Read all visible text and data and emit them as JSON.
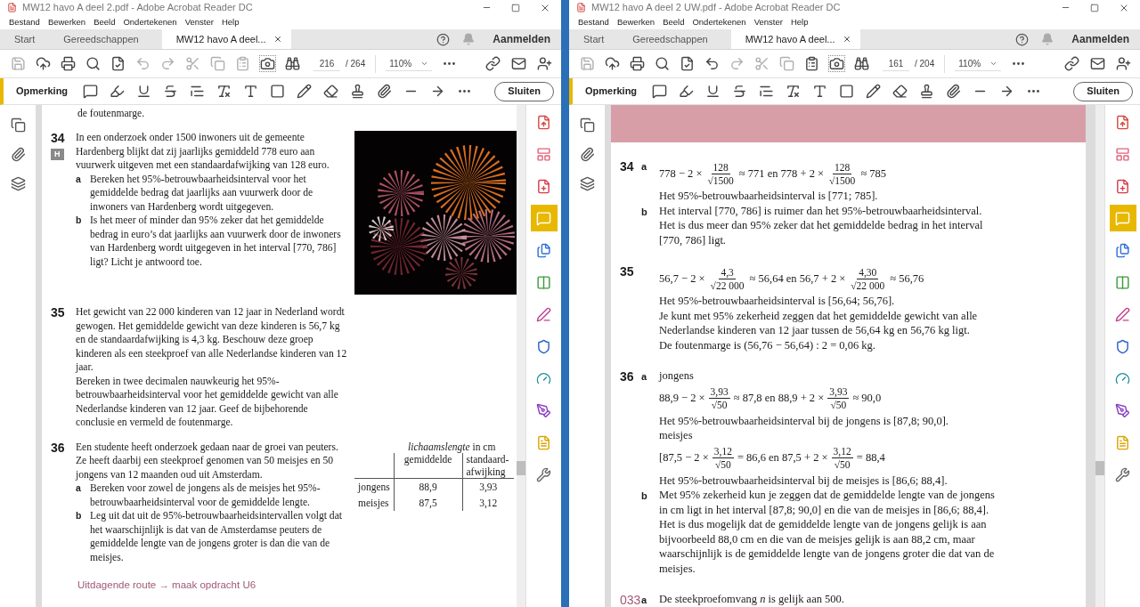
{
  "windows": [
    {
      "title": "MW12 havo A deel 2.pdf - Adobe Acrobat Reader DC",
      "menu": [
        "Bestand",
        "Bewerken",
        "Beeld",
        "Ondertekenen",
        "Venster",
        "Help"
      ],
      "tabs": [
        {
          "label": "Start",
          "selected": false
        },
        {
          "label": "Gereedschappen",
          "selected": false
        },
        {
          "label": "MW12 havo A deel...",
          "selected": true
        }
      ],
      "sign_in": "Aanmelden",
      "toolbar": {
        "page": "216",
        "total": "/ 264",
        "zoom": "110%",
        "undo_enabled": false,
        "paste_enabled": false
      },
      "comment_bar": {
        "label": "Opmerking",
        "close": "Sluiten"
      },
      "tools": [
        {
          "kind": "export",
          "selected": false
        },
        {
          "kind": "layout",
          "selected": false
        },
        {
          "kind": "create",
          "selected": false
        },
        {
          "kind": "comment",
          "selected": true
        },
        {
          "kind": "combine",
          "selected": false
        },
        {
          "kind": "organize",
          "selected": false
        },
        {
          "kind": "fill",
          "selected": false
        },
        {
          "kind": "protect",
          "selected": false
        },
        {
          "kind": "optimize",
          "selected": false
        },
        {
          "kind": "sign",
          "selected": false
        },
        {
          "kind": "send",
          "selected": false
        },
        {
          "kind": "more",
          "selected": false
        }
      ],
      "page": {
        "kind": "exercises",
        "header_band": false,
        "blocks": [
          {
            "kind": "text",
            "text": "de foutenmarge."
          },
          {
            "kind": "exercise",
            "number": "34",
            "badge": "H",
            "paragraphs": [
              "In een onderzoek onder 1500 inwoners uit de gemeente Hardenberg blijkt dat zij jaarlijks gemiddeld 778 euro aan vuurwerk uitgeven met een standaardafwijking van 128 euro."
            ],
            "items": [
              {
                "letter": "a",
                "text": "Bereken het 95%-betrouwbaarheidsinterval voor het gemiddelde bedrag dat jaarlijks aan vuurwerk door de inwoners van Hardenberg wordt uitgegeven."
              },
              {
                "letter": "b",
                "text": "Is het meer of minder dan 95% zeker dat het gemiddelde bedrag in euro’s dat jaarlijks aan vuurwerk door de inwoners van Hardenberg wordt uitgegeven in het interval [770, 786] ligt? Licht je antwoord toe."
              }
            ],
            "aside": {
              "kind": "picture"
            }
          },
          {
            "kind": "exercise",
            "number": "35",
            "paragraphs": [
              "Het gewicht van 22 000 kinderen van 12 jaar in Nederland wordt gewogen. Het gemiddelde gewicht van deze kinderen is 56,7 kg en de standaardafwijking is 4,3 kg. Beschouw deze groep kinderen als een steekproef van alle Nederlandse kinderen van 12 jaar.",
              "Bereken in twee decimalen nauwkeurig het 95%-betrouwbaarheidsinterval voor het gemiddelde gewicht van alle Nederlandse kinderen van 12 jaar. Geef de bijbehorende conclusie en vermeld de foutenmarge."
            ]
          },
          {
            "kind": "exercise",
            "number": "36",
            "paragraphs": [
              "Een studente heeft onderzoek gedaan naar de groei van peuters. Ze heeft daarbij een steekproef genomen van 50 meisjes en 50 jongens van 12 maanden oud uit Amsterdam."
            ],
            "items": [
              {
                "letter": "a",
                "text": "Bereken voor zowel de jongens als de meisjes het 95%-betrouwbaarheidsinterval voor de gemiddelde lengte."
              },
              {
                "letter": "b",
                "text": "Leg uit dat uit de 95%-betrouwbaarheidsintervallen volgt dat het waarschijnlijk is dat van de Amsterdamse peuters de gemiddelde lengte van de jongens groter is dan die van de meisjes."
              }
            ],
            "aside": {
              "kind": "table",
              "caption": "*lichaamslengte* in cm",
              "columns": [
                "",
                "gemiddelde",
                "standaard-afwijking"
              ],
              "rows": [
                [
                  "jongens",
                  "88,9",
                  "3,93"
                ],
                [
                  "meisjes",
                  "87,5",
                  "3,12"
                ]
              ]
            }
          },
          {
            "kind": "link",
            "text": "Uitdagende route → maak opdracht U6"
          }
        ]
      }
    },
    {
      "title": "MW12 havo A deel 2 UW.pdf - Adobe Acrobat Reader DC",
      "menu": [
        "Bestand",
        "Bewerken",
        "Beeld",
        "Ondertekenen",
        "Venster",
        "Help"
      ],
      "tabs": [
        {
          "label": "Start",
          "selected": false
        },
        {
          "label": "Gereedschappen",
          "selected": false
        },
        {
          "label": "MW12 havo A deel...",
          "selected": true
        }
      ],
      "sign_in": "Aanmelden",
      "toolbar": {
        "page": "161",
        "total": "/ 204",
        "zoom": "110%",
        "undo_enabled": true,
        "paste_enabled": true
      },
      "comment_bar": {
        "label": "Opmerking",
        "close": "Sluiten"
      },
      "tools": [
        {
          "kind": "export",
          "selected": false
        },
        {
          "kind": "layout",
          "selected": false
        },
        {
          "kind": "create",
          "selected": false
        },
        {
          "kind": "comment",
          "selected": true
        },
        {
          "kind": "combine",
          "selected": false
        },
        {
          "kind": "organize",
          "selected": false
        },
        {
          "kind": "fill",
          "selected": false
        },
        {
          "kind": "protect",
          "selected": false
        },
        {
          "kind": "optimize",
          "selected": false
        },
        {
          "kind": "sign",
          "selected": false
        },
        {
          "kind": "send",
          "selected": false
        },
        {
          "kind": "more",
          "selected": false
        }
      ],
      "page": {
        "kind": "answers",
        "header_band": true,
        "answers": [
          {
            "number": "34",
            "accent": false,
            "parts": [
              {
                "letter": "a",
                "lines": [
                  {
                    "kind": "formula",
                    "tokens": [
                      {
                        "t": "778 − 2 ×"
                      },
                      {
                        "num": "128",
                        "den": "√1500"
                      },
                      {
                        "t": "≈ 771 en 778 + 2 ×"
                      },
                      {
                        "num": "128",
                        "den": "√1500"
                      },
                      {
                        "t": "≈ 785"
                      }
                    ]
                  },
                  {
                    "kind": "text",
                    "text": "Het 95%-betrouwbaarheidsinterval is [771; 785]."
                  }
                ]
              },
              {
                "letter": "b",
                "lines": [
                  {
                    "kind": "text",
                    "text": "Het interval [770, 786] is ruimer dan het 95%-betrouwbaarheidsinterval."
                  },
                  {
                    "kind": "text",
                    "text": "Het is dus meer dan 95% zeker dat het gemiddelde bedrag in het interval [770, 786] ligt."
                  }
                ]
              }
            ]
          },
          {
            "number": "35",
            "accent": false,
            "parts": [
              {
                "lines": [
                  {
                    "kind": "formula",
                    "tokens": [
                      {
                        "t": "56,7 − 2 ×"
                      },
                      {
                        "num": "4,3",
                        "den": "√22 000"
                      },
                      {
                        "t": "≈ 56,64 en 56,7 + 2 ×"
                      },
                      {
                        "num": "4,30",
                        "den": "√22 000"
                      },
                      {
                        "t": "≈ 56,76"
                      }
                    ]
                  },
                  {
                    "kind": "text",
                    "text": "Het 95%-betrouwbaarheidsinterval is [56,64; 56,76]."
                  },
                  {
                    "kind": "text",
                    "text": "Je kunt met 95% zekerheid zeggen dat het gemiddelde gewicht van alle Nederlandse kinderen van 12 jaar tussen de 56,64 kg en 56,76 kg ligt."
                  },
                  {
                    "kind": "text",
                    "text": "De foutenmarge is (56,76 − 56,64) : 2 = 0,06 kg."
                  }
                ]
              }
            ]
          },
          {
            "number": "36",
            "accent": false,
            "parts": [
              {
                "letter": "a",
                "lines": [
                  {
                    "kind": "text",
                    "text": "jongens"
                  },
                  {
                    "kind": "formula",
                    "tokens": [
                      {
                        "t": "88,9 − 2 ×"
                      },
                      {
                        "num": "3,93",
                        "den": "√50"
                      },
                      {
                        "t": "≈ 87,8 en 88,9 + 2 ×"
                      },
                      {
                        "num": "3,93",
                        "den": "√50"
                      },
                      {
                        "t": "≈ 90,0"
                      }
                    ]
                  },
                  {
                    "kind": "text",
                    "text": "Het 95%-betrouwbaarheidsinterval bij de jongens is [87,8; 90,0]."
                  },
                  {
                    "kind": "text",
                    "text": "meisjes"
                  },
                  {
                    "kind": "formula",
                    "tokens": [
                      {
                        "t": "[87,5 − 2 ×"
                      },
                      {
                        "num": "3,12",
                        "den": "√50"
                      },
                      {
                        "t": "= 86,6 en 87,5 + 2 ×"
                      },
                      {
                        "num": "3,12",
                        "den": "√50"
                      },
                      {
                        "t": "= 88,4"
                      }
                    ]
                  },
                  {
                    "kind": "text",
                    "text": "Het 95%-betrouwbaarheidsinterval bij de meisjes is [86,6; 88,4]."
                  }
                ]
              },
              {
                "letter": "b",
                "lines": [
                  {
                    "kind": "text",
                    "text": "Met 95% zekerheid kun je zeggen dat de gemiddelde lengte van de jongens in cm ligt in het interval [87,8; 90,0] en die van de meisjes in [86,6; 88,4]."
                  },
                  {
                    "kind": "text",
                    "text": "Het is dus mogelijk dat de gemiddelde lengte van de jongens gelijk is aan bijvoorbeeld 88,0 cm en die van de meisjes gelijk is aan 88,2 cm, maar waarschijnlijk is de gemiddelde lengte van de jongens groter die dat van de meisjes."
                  }
                ]
              }
            ]
          },
          {
            "number": "033",
            "accent": true,
            "parts": [
              {
                "letter": "a",
                "lines": [
                  {
                    "kind": "text",
                    "text": "De steekproefomvang *n* is gelijk aan 500."
                  }
                ]
              }
            ]
          }
        ]
      }
    }
  ]
}
